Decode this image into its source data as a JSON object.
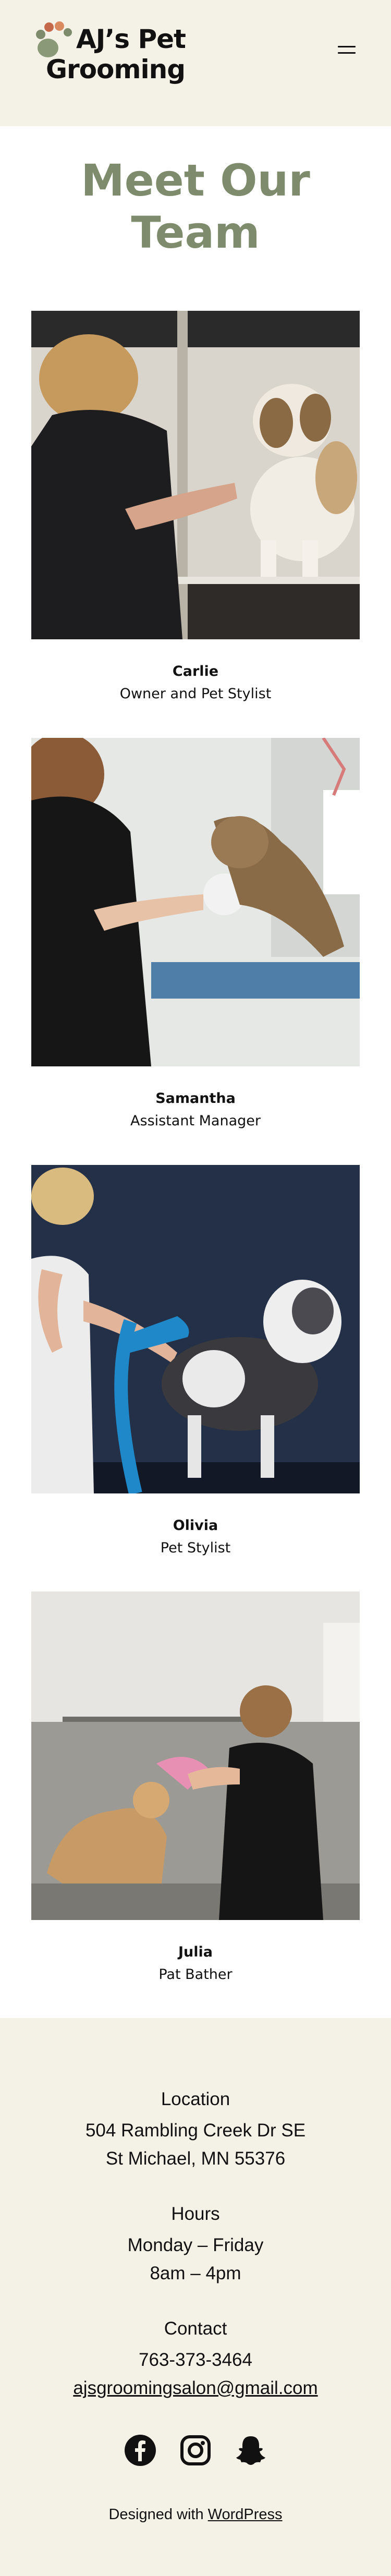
{
  "header": {
    "logo_line1": "AJ’s Pet",
    "logo_line2": "Grooming",
    "menu_icon": "hamburger-menu-icon"
  },
  "page_title": {
    "line1": "Meet Our",
    "line2": "Team"
  },
  "team": [
    {
      "name": "Carlie",
      "role": "Owner and Pet Stylist"
    },
    {
      "name": "Samantha",
      "role": "Assistant Manager"
    },
    {
      "name": "Olivia",
      "role": "Pet Stylist"
    },
    {
      "name": "Julia",
      "role": "Pat Bather"
    }
  ],
  "footer": {
    "location_heading": "Location",
    "address_line1": "504 Rambling Creek Dr SE",
    "address_line2": "St Michael, MN 55376",
    "hours_heading": "Hours",
    "hours_days": "Monday – Friday",
    "hours_time": "8am – 4pm",
    "contact_heading": "Contact",
    "phone": "763-373-3464",
    "email": "ajsgroomingsalon@gmail.com",
    "social_icons": [
      "facebook-icon",
      "instagram-icon",
      "snapchat-icon"
    ],
    "credit_prefix": "Designed with",
    "credit_link": "WordPress"
  },
  "colors": {
    "header_bg": "#f4f1e6",
    "title_green": "#7e8c6d",
    "footer_bg": "#f4f1e6"
  }
}
